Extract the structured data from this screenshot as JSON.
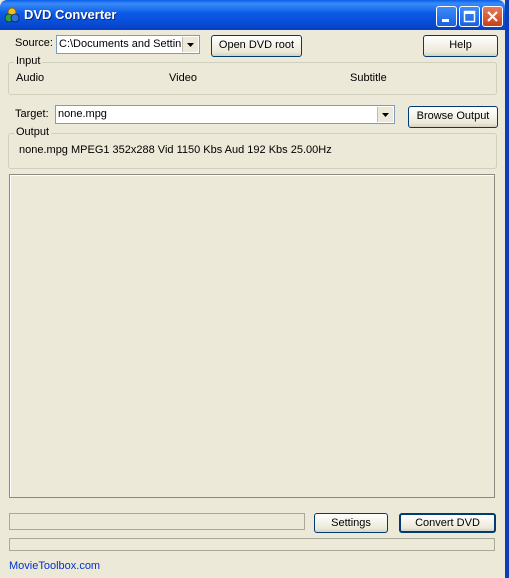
{
  "window": {
    "title": "DVD Converter",
    "icon": "dvd-converter-app-icon"
  },
  "title_buttons": {
    "minimize": "minimize-icon",
    "maximize": "maximize-icon",
    "close": "close-icon"
  },
  "source": {
    "label": "Source:",
    "value": "C:\\Documents and Settin"
  },
  "buttons": {
    "open_dvd_root": "Open DVD root",
    "help": "Help",
    "browse_output": "Browse Output",
    "settings": "Settings",
    "convert_dvd": "Convert DVD"
  },
  "input_group": {
    "title": "Input",
    "audio": "Audio",
    "video": "Video",
    "subtitle": "Subtitle"
  },
  "target": {
    "label": "Target:",
    "value": "none.mpg"
  },
  "output_group": {
    "title": "Output",
    "info": "none.mpg MPEG1 352x288 Vid 1150 Kbs Aud 192 Kbs 25.00Hz"
  },
  "progress": {
    "top": 0,
    "bottom": 0
  },
  "footer": {
    "link": "MovieToolbox.com"
  },
  "colors": {
    "titlebar": "#0b5ae6",
    "face": "#ece9d8",
    "link": "#0033cc"
  }
}
